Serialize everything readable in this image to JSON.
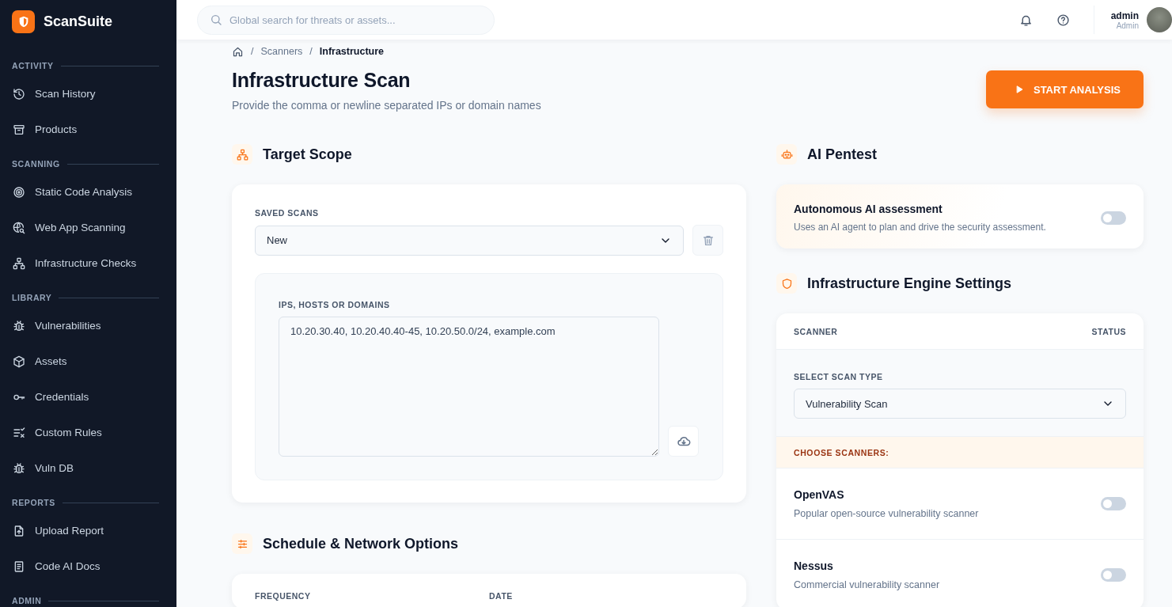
{
  "app": {
    "name": "ScanSuite"
  },
  "sidebar": {
    "sections": [
      {
        "title": "ACTIVITY",
        "items": [
          {
            "label": "Scan History",
            "selected": false
          },
          {
            "label": "Products",
            "selected": false
          }
        ]
      },
      {
        "title": "SCANNING",
        "items": [
          {
            "label": "Static Code Analysis",
            "selected": false
          },
          {
            "label": "Web App Scanning",
            "selected": false
          },
          {
            "label": "Infrastructure Checks",
            "selected": false
          }
        ]
      },
      {
        "title": "LIBRARY",
        "items": [
          {
            "label": "Vulnerabilities",
            "selected": false
          },
          {
            "label": "Assets",
            "selected": false
          },
          {
            "label": "Credentials",
            "selected": false
          },
          {
            "label": "Custom Rules",
            "selected": false
          },
          {
            "label": "Vuln DB",
            "selected": false
          }
        ]
      },
      {
        "title": "REPORTS",
        "items": [
          {
            "label": "Upload Report",
            "selected": false
          },
          {
            "label": "Code AI Docs",
            "selected": false
          }
        ]
      },
      {
        "title": "ADMIN"
      }
    ]
  },
  "topbar": {
    "search": {
      "placeholder": "Global search for threats or assets..."
    },
    "user": {
      "name": "admin",
      "role": "Admin"
    }
  },
  "breadcrumb": [
    {
      "separator": "/",
      "label": "Scanners"
    },
    {
      "separator": "/",
      "label": "Infrastructure"
    }
  ],
  "page": {
    "title": "Infrastructure Scan",
    "subtitle": "Provide the comma or newline separated IPs or domain names",
    "start_button": "START ANALYSIS"
  },
  "target_scope": {
    "title": "Target Scope",
    "saved_scans": {
      "label": "SAVED SCANS",
      "value": "New"
    },
    "targets": {
      "label": "IPS, HOSTS OR DOMAINS",
      "value": "10.20.30.40, 10.20.40.40-45, 10.20.50.0/24, example.com"
    }
  },
  "schedule": {
    "title": "Schedule & Network Options",
    "fields": [
      "FREQUENCY",
      "DATE"
    ]
  },
  "ai_pentest": {
    "title": "AI Pentest",
    "option": {
      "title": "Autonomous AI assessment",
      "description": "Uses an AI agent to plan and drive the security assessment.",
      "on": false
    }
  },
  "engine": {
    "title": "Infrastructure Engine Settings",
    "columns": [
      "SCANNER",
      "STATUS"
    ],
    "scan_type": {
      "label": "SELECT SCAN TYPE",
      "value": "Vulnerability Scan"
    },
    "choose_label": "CHOOSE SCANNERS:",
    "scanners": [
      {
        "name": "OpenVAS",
        "description": "Popular open-source vulnerability scanner",
        "on": false
      },
      {
        "name": "Nessus",
        "description": "Commercial vulnerability scanner",
        "on": false
      }
    ]
  }
}
